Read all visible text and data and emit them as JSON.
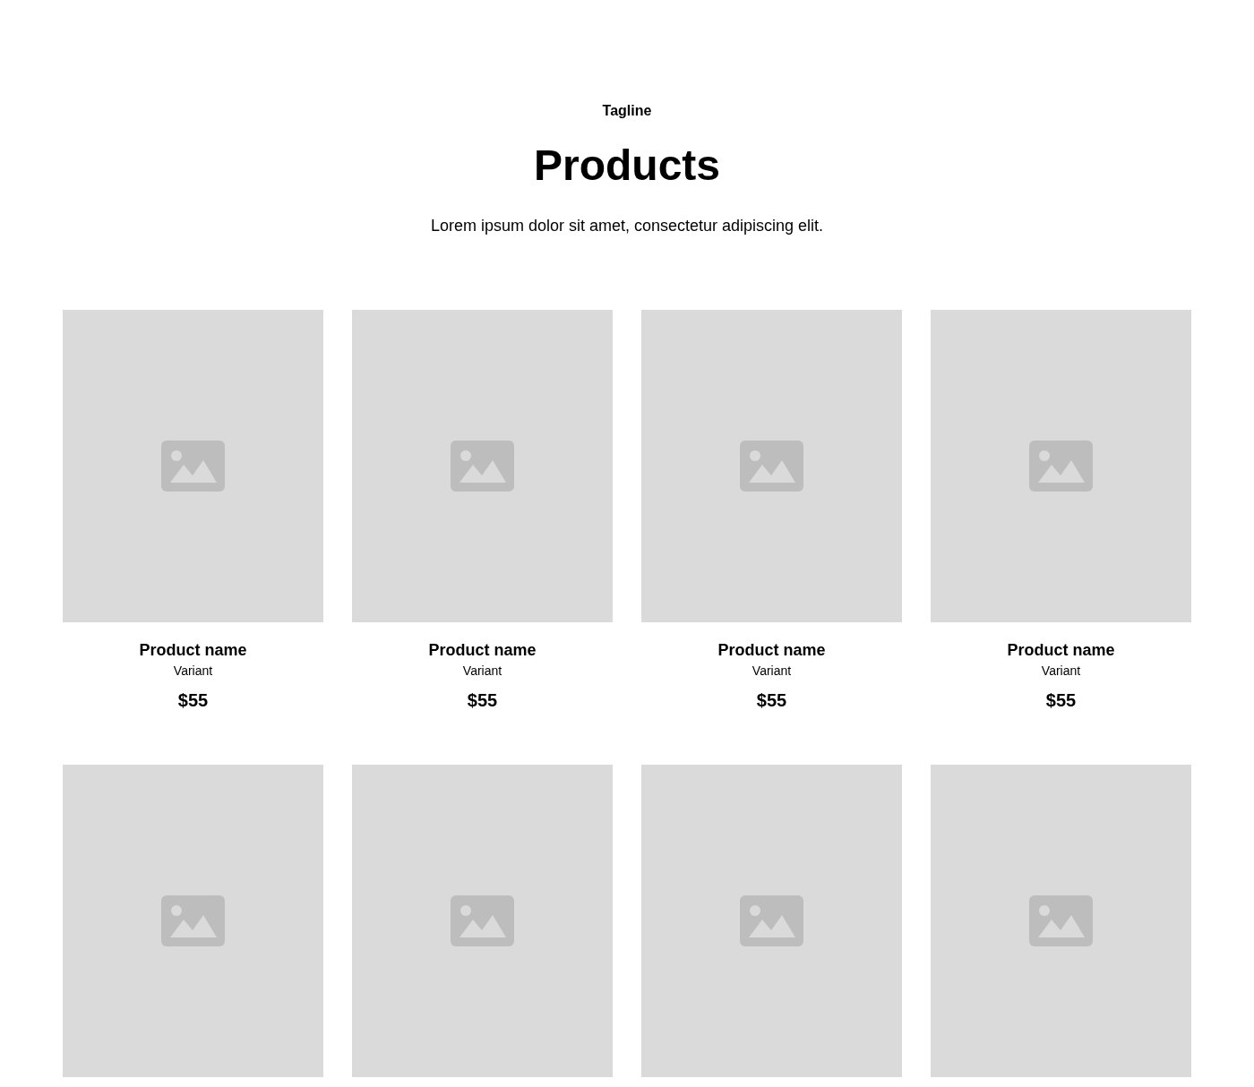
{
  "header": {
    "tagline": "Tagline",
    "title": "Products",
    "description": "Lorem ipsum dolor sit amet, consectetur adipiscing elit."
  },
  "products": [
    {
      "kind": "card",
      "name": "Product name",
      "variant": "Variant",
      "price": "$55"
    },
    {
      "kind": "card",
      "name": "Product name",
      "variant": "Variant",
      "price": "$55"
    },
    {
      "kind": "card",
      "name": "Product name",
      "variant": "Variant",
      "price": "$55"
    },
    {
      "kind": "card",
      "name": "Product name",
      "variant": "Variant",
      "price": "$55"
    },
    {
      "kind": "image_only"
    },
    {
      "kind": "image_only"
    },
    {
      "kind": "image_only"
    },
    {
      "kind": "image_only"
    }
  ]
}
